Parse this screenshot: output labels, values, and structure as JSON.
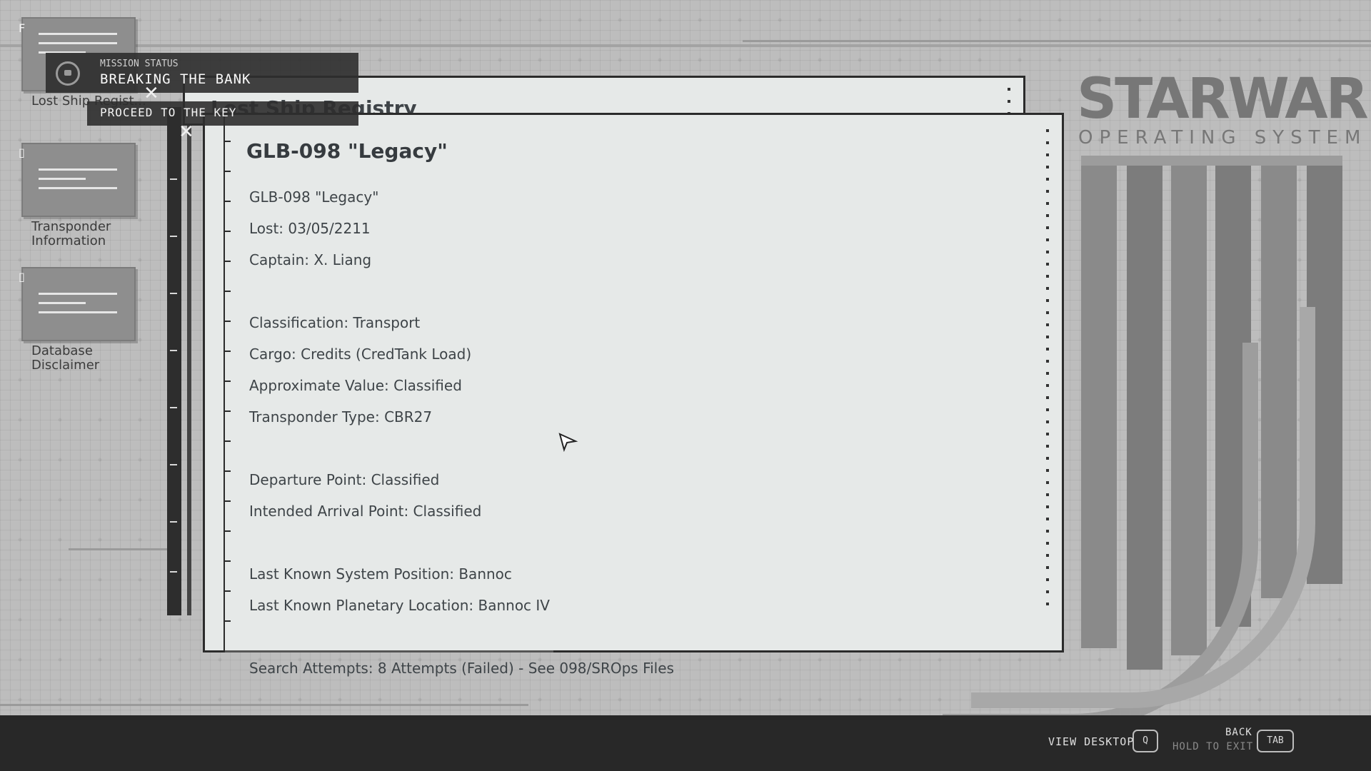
{
  "brand": {
    "name": "STARWARE",
    "subtitle": "OPERATING SYSTEM"
  },
  "desktop_icons": [
    {
      "tag": "F",
      "label": "Lost Ship Regist..."
    },
    {
      "tag": "▯",
      "label_line1": "Transponder",
      "label_line2": "Information"
    },
    {
      "tag": "▯",
      "label_line1": "Database",
      "label_line2": "Disclaimer"
    }
  ],
  "mission": {
    "header": "MISSION STATUS",
    "title": "BREAKING THE BANK",
    "objective": "PROCEED TO THE KEY",
    "skull_icon": "skull-icon"
  },
  "back_window": {
    "title": "Lost Ship Registry"
  },
  "main_window": {
    "title": "GLB-098 \"Legacy\"",
    "lines": {
      "l1": "GLB-098 \"Legacy\"",
      "l2": "Lost: 03/05/2211",
      "l3": "Captain: X. Liang",
      "l4": "Classification: Transport",
      "l5": "Cargo: Credits (CredTank Load)",
      "l6": "Approximate Value: Classified",
      "l7": "Transponder Type: CBR27",
      "l8": "Departure Point: Classified",
      "l9": "Intended Arrival Point: Classified",
      "l10": "Last Known System Position: Bannoc",
      "l11": "Last Known Planetary Location: Bannoc IV",
      "l12": "Search Attempts: 8 Attempts (Failed) - See 098/SROps Files"
    }
  },
  "bottom_bar": {
    "view_desktop": "VIEW DESKTOP",
    "view_desktop_key": "Q",
    "back": "BACK",
    "hold_to_exit": "HOLD TO EXIT",
    "back_key": "TAB"
  },
  "colors": {
    "bar": "#282828",
    "window": "#e6e9e8",
    "background": "#bdbdbd"
  }
}
